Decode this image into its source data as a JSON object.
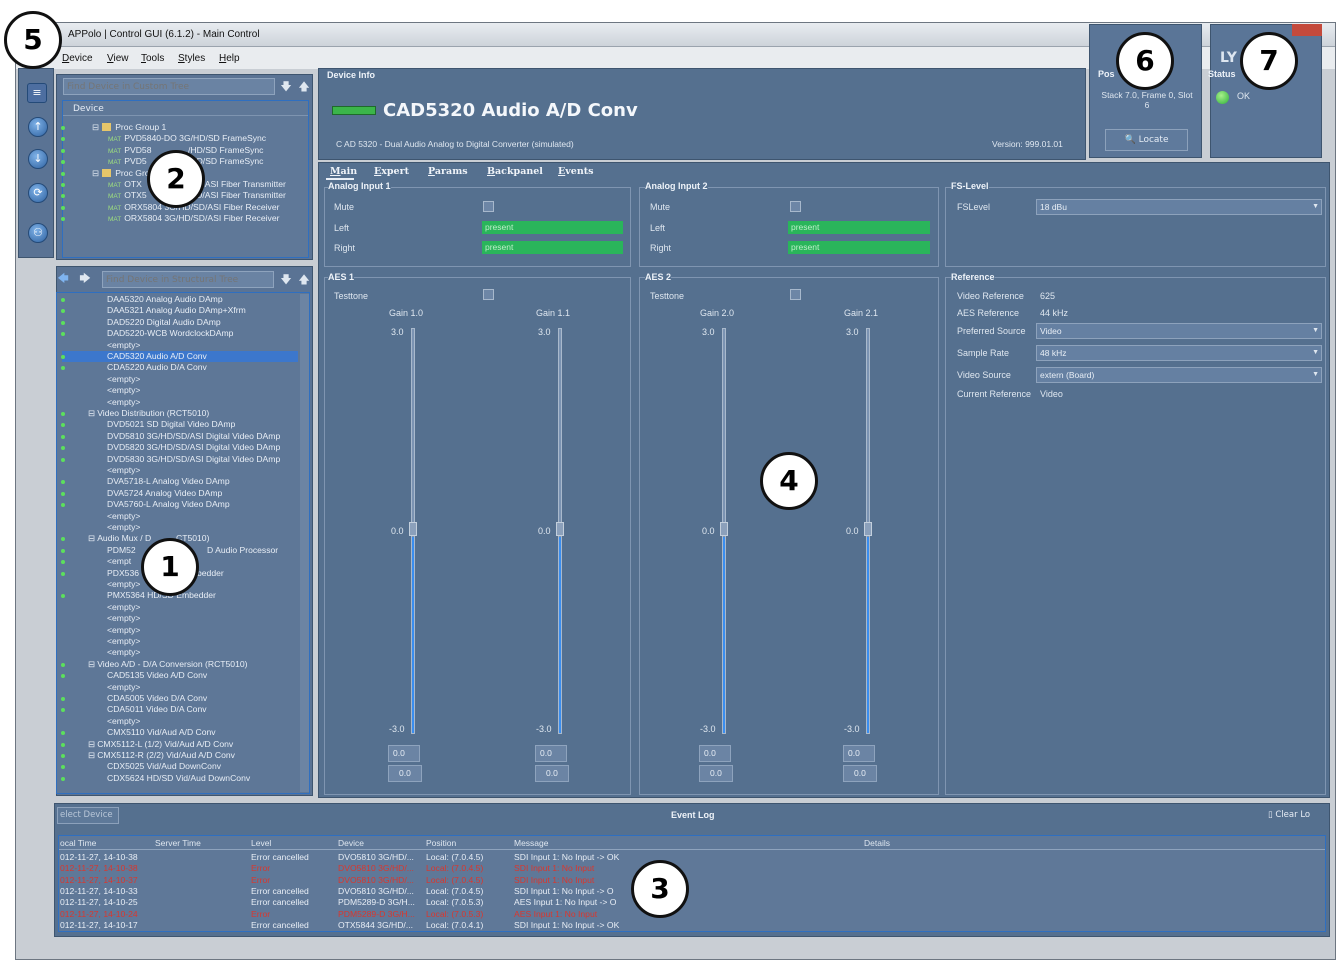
{
  "window": {
    "title": "APPolo | Control GUI (6.1.2) - Main Control",
    "menu": [
      "Device",
      "View",
      "Tools",
      "Styles",
      "Help"
    ]
  },
  "custom_tree": {
    "search_placeholder": "Find Device in Custom Tree",
    "header": "Device",
    "rows": [
      {
        "text": "Proc Group 1",
        "type": "group"
      },
      {
        "text": "PVD5840-DO 3G/HD/SD FrameSync",
        "type": "device"
      },
      {
        "text": "PVD58",
        "suffix": "/HD/SD FrameSync",
        "type": "device"
      },
      {
        "text": "PVD5",
        "suffix": "/HD/SD FrameSync",
        "type": "device"
      },
      {
        "text": "Proc Gro",
        "type": "group"
      },
      {
        "text": "OTX",
        "suffix": "/SD/ASI Fiber Transmitter",
        "type": "device"
      },
      {
        "text": "OTX5",
        "suffix": "/SD/ASI Fiber Transmitter",
        "type": "device"
      },
      {
        "text": "ORX5804 3G/HD/SD/ASI Fiber Receiver",
        "type": "device"
      },
      {
        "text": "ORX5804 3G/HD/SD/ASI Fiber Receiver",
        "type": "device"
      }
    ],
    "tag": "MAT"
  },
  "structural_tree": {
    "search_placeholder": "Find Device in Structural Tree",
    "rows": [
      "DAA5320 Analog Audio DAmp",
      "DAA5321 Analog Audio DAmp+Xfrm",
      "DAD5220 Digital Audio DAmp",
      "DAD5220-WCB WordclockDAmp",
      "<empty>",
      "CAD5320 Audio A/D Conv",
      "CDA5220 Audio D/A Conv",
      "<empty>",
      "<empty>",
      "<empty>",
      "Video Distribution (RCT5010)",
      "DVD5021 SD Digital Video DAmp",
      "DVD5810 3G/HD/SD/ASI Digital Video DAmp",
      "DVD5820 3G/HD/SD/ASI Digital Video DAmp",
      "DVD5830 3G/HD/SD/ASI Digital Video DAmp",
      "<empty>",
      "DVA5718-L Analog Video DAmp",
      "DVA5724 Analog Video DAmp",
      "DVA5760-L Analog Video DAmp",
      "<empty>",
      "<empty>",
      "Audio Mux / D",
      "PDM52",
      "<empt",
      "PDX536",
      "<empty>",
      "PMX5364 HD/SD Embedder",
      "<empty>",
      "<empty>",
      "<empty>",
      "<empty>",
      "<empty>",
      "Video A/D - D/A Conversion (RCT5010)",
      "CAD5135 Video A/D Conv",
      "<empty>",
      "CDA5005 Video D/A Conv",
      "CDA5011 Video D/A Conv",
      "<empty>",
      "CMX5110 Vid/Aud A/D Conv",
      "CMX5112-L (1/2) Vid/Aud A/D Conv",
      "CMX5112-R (2/2) Vid/Aud A/D Conv",
      "CDX5025 Vid/Aud DownConv",
      "CDX5624 HD/SD Vid/Aud DownConv"
    ],
    "row_suffixes": {
      "21": "CT5010)",
      "22": "D Audio Processor",
      "24": "bedder"
    },
    "selected_index": 5
  },
  "device_info": {
    "section_title": "Device Info",
    "device_name": "CAD5320 Audio A/D Conv",
    "description": "C AD 5320 - Dual Audio Analog to Digital Converter (simulated)",
    "version": "Version: 999.01.01"
  },
  "position": {
    "title": "Pos",
    "value": "Stack 7.0, Frame 0, Slot 6",
    "locate_label": "Locate"
  },
  "status": {
    "title": "Status",
    "value": "OK",
    "logo": "LY"
  },
  "tabs": [
    "Main",
    "Expert",
    "Params",
    "Backpanel",
    "Events"
  ],
  "analog_input_1": {
    "title": "Analog Input 1",
    "mute": "Mute",
    "left": "Left",
    "right": "Right",
    "left_value": "present",
    "right_value": "present"
  },
  "analog_input_2": {
    "title": "Analog Input 2",
    "mute": "Mute",
    "left": "Left",
    "right": "Right",
    "left_value": "present",
    "right_value": "present"
  },
  "fs_level": {
    "title": "FS-Level",
    "label": "FSLevel",
    "value": "18 dBu"
  },
  "aes1": {
    "title": "AES 1",
    "testtone": "Testtone",
    "gains": [
      {
        "label": "Gain 1.0",
        "top": "3.0",
        "mid": "0.0",
        "bottom": "-3.0",
        "value": "0.0",
        "value2": "0.0"
      },
      {
        "label": "Gain 1.1",
        "top": "3.0",
        "mid": "0.0",
        "bottom": "-3.0",
        "value": "0.0",
        "value2": "0.0"
      }
    ]
  },
  "aes2": {
    "title": "AES 2",
    "testtone": "Testtone",
    "gains": [
      {
        "label": "Gain 2.0",
        "top": "3.0",
        "mid": "0.0",
        "bottom": "-3.0",
        "value": "0.0",
        "value2": "0.0"
      },
      {
        "label": "Gain 2.1",
        "top": "3.0",
        "mid": "0.0",
        "bottom": "-3.0",
        "value": "0.0",
        "value2": "0.0"
      }
    ]
  },
  "reference": {
    "title": "Reference",
    "video_reference_label": "Video Reference",
    "video_reference": "625",
    "aes_reference_label": "AES Reference",
    "aes_reference": "44 kHz",
    "preferred_source_label": "Preferred Source",
    "preferred_source": "Video",
    "sample_rate_label": "Sample Rate",
    "sample_rate": "48 kHz",
    "video_source_label": "Video Source",
    "video_source": "extern (Board)",
    "current_reference_label": "Current Reference",
    "current_reference": "Video"
  },
  "event_log": {
    "title": "Event Log",
    "select_device": "elect Device",
    "clear_log": "Clear Lo",
    "columns": [
      "ocal Time",
      "Server Time",
      "Level",
      "Device",
      "Position",
      "Message",
      "Details"
    ],
    "rows": [
      {
        "time": "012-11-27, 14-10-38",
        "level": "Error cancelled",
        "device": "DVO5810 3G/HD/...",
        "position": "Local: (7.0.4.5)",
        "message": "SDI Input 1: No Input -> OK",
        "kind": "ok"
      },
      {
        "time": "012-11-27, 14-10-38",
        "level": "Error",
        "device": "DVO5810 3G/HD/...",
        "position": "Local: (7.0.4.5)",
        "message": "SDI Input 1: No Input",
        "kind": "err"
      },
      {
        "time": "012-11-27, 14-10-37",
        "level": "Error",
        "device": "DVO5810 3G/HD/...",
        "position": "Local: (7.0.4.5)",
        "message": "SDI Input 1: No Input",
        "kind": "err"
      },
      {
        "time": "012-11-27, 14-10-33",
        "level": "Error cancelled",
        "device": "DVO5810 3G/HD/...",
        "position": "Local: (7.0.4.5)",
        "message": "SDI Input 1: No Input -> O",
        "kind": "ok"
      },
      {
        "time": "012-11-27, 14-10-25",
        "level": "Error cancelled",
        "device": "PDM5289-D 3G/H...",
        "position": "Local: (7.0.5.3)",
        "message": "AES Input 1: No Input -> O",
        "kind": "ok"
      },
      {
        "time": "012-11-27, 14-10-24",
        "level": "Error",
        "device": "PDM5289-D 3G/H...",
        "position": "Local: (7.0.5.3)",
        "message": "AES Input 1: No Input",
        "kind": "err"
      },
      {
        "time": "012-11-27, 14-10-17",
        "level": "Error cancelled",
        "device": "OTX5844 3G/HD/...",
        "position": "Local: (7.0.4.1)",
        "message": "SDI Input 1: No Input -> OK",
        "kind": "ok"
      }
    ]
  },
  "callouts": [
    "1",
    "2",
    "3",
    "4",
    "5",
    "6",
    "7"
  ]
}
